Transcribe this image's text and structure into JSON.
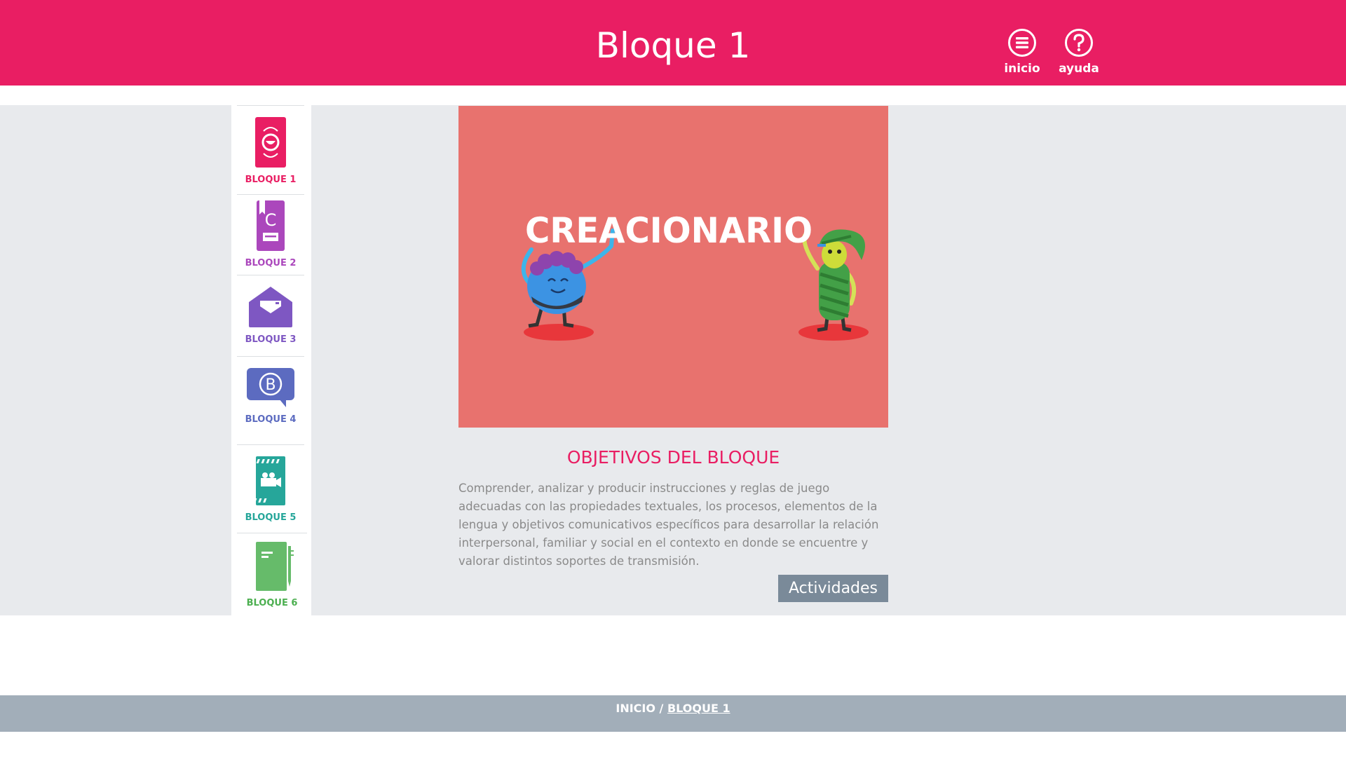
{
  "header": {
    "title": "Bloque 1",
    "nav": [
      {
        "label": "inicio",
        "icon": "menu-icon"
      },
      {
        "label": "ayuda",
        "icon": "help-icon"
      }
    ]
  },
  "sidebar": {
    "items": [
      {
        "label": "BLOQUE 1",
        "color": "#e91e63",
        "icon": "phone-face-icon"
      },
      {
        "label": "BLOQUE 2",
        "color": "#ab47bc",
        "icon": "book-c-icon"
      },
      {
        "label": "BLOQUE 3",
        "color": "#7e57c2",
        "icon": "envelope-icon"
      },
      {
        "label": "BLOQUE 4",
        "color": "#5c6bc0",
        "icon": "speech-bubble-b-icon"
      },
      {
        "label": "BLOQUE 5",
        "color": "#26a69a",
        "icon": "film-camera-icon"
      },
      {
        "label": "BLOQUE 6",
        "color": "#66bb6a",
        "icon": "notebook-pencil-icon"
      }
    ]
  },
  "hero": {
    "title": "CREACIONARIO",
    "background": "#e8726e"
  },
  "objectives": {
    "title": "OBJETIVOS DEL BLOQUE",
    "text": "Comprender, analizar y producir instrucciones y reglas de juego adecuadas con las propiedades textuales, los procesos, elementos de la lengua y objetivos comunicativos específicos para desarrollar la relación interpersonal, familiar y social en el contexto en donde se encuentre y valorar distintos soportes de transmisión."
  },
  "actions": {
    "activities_label": "Actividades"
  },
  "breadcrumb": {
    "home": "INICIO",
    "separator": " / ",
    "current": "BLOQUE 1"
  },
  "colors": {
    "brand": "#e91e63",
    "band": "#e8eaed",
    "footer": "#a2aeb9",
    "button": "#7a8a99"
  }
}
